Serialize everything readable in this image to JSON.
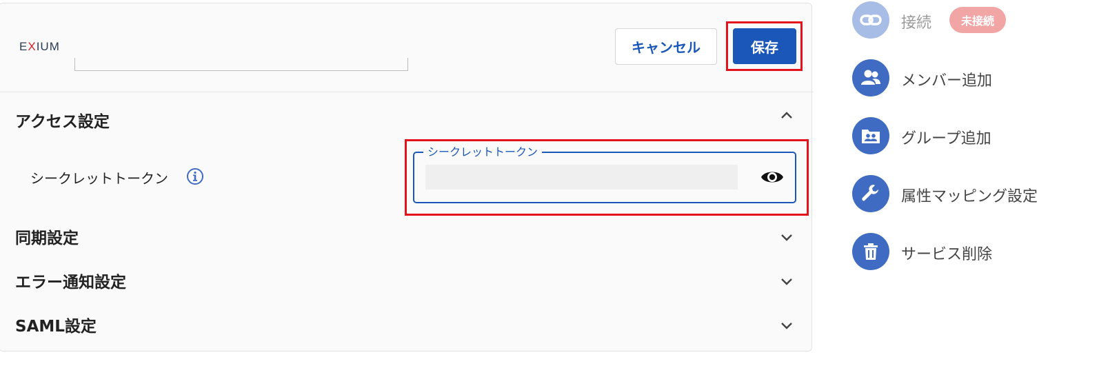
{
  "header": {
    "logo_prefix": "E",
    "logo_x": "X",
    "logo_suffix": "IUM",
    "cancel_label": "キャンセル",
    "save_label": "保存"
  },
  "sections": {
    "access": {
      "title": "アクセス設定",
      "state": "expanded"
    },
    "sync": {
      "title": "同期設定",
      "state": "collapsed"
    },
    "error_notify": {
      "title": "エラー通知設定",
      "state": "collapsed"
    },
    "saml": {
      "title": "SAML設定",
      "state": "collapsed"
    }
  },
  "secret_token": {
    "label": "シークレットトークン",
    "field_legend": "シークレットトークン",
    "value": ""
  },
  "sidebar": {
    "items": [
      {
        "label": "接続",
        "badge": "未接続",
        "icon": "link-icon",
        "disabled": true
      },
      {
        "label": "メンバー追加",
        "icon": "add-member-icon"
      },
      {
        "label": "グループ追加",
        "icon": "add-group-icon"
      },
      {
        "label": "属性マッピング設定",
        "icon": "wrench-icon"
      },
      {
        "label": "サービス削除",
        "icon": "trash-icon"
      }
    ]
  },
  "colors": {
    "primary": "#1a57b8",
    "highlight": "#e3121d",
    "sidebar_icon": "#3f6bc2",
    "badge": "#f2a5a5"
  }
}
